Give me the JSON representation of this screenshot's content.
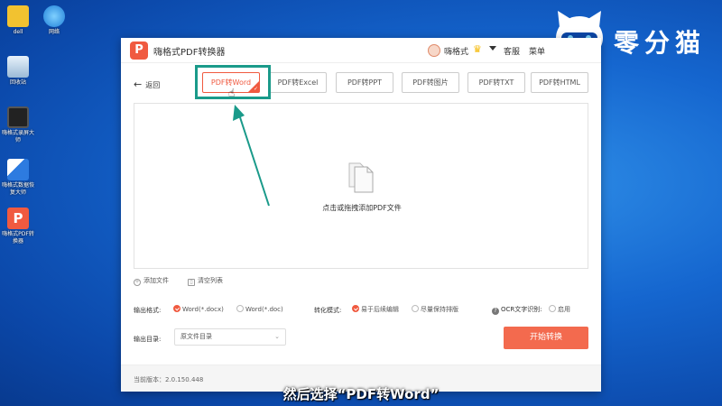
{
  "desktop": {
    "icons": [
      {
        "label": "dell"
      },
      {
        "label": "网络"
      },
      {
        "label": "回收站"
      },
      {
        "label": "嗨格式录屏大师"
      },
      {
        "label": "嗨格式数据恢复大师"
      },
      {
        "label": "嗨格式PDF转换器"
      }
    ]
  },
  "brand": {
    "name": "零分猫"
  },
  "app": {
    "logo": "P",
    "title": "嗨格式PDF转换器",
    "user": "嗨格式",
    "service": "客服",
    "menu": "菜单"
  },
  "nav": {
    "back": "返回"
  },
  "tabs": [
    {
      "label": "PDF转Word",
      "active": true
    },
    {
      "label": "PDF转Excel"
    },
    {
      "label": "PDF转PPT"
    },
    {
      "label": "PDF转图片"
    },
    {
      "label": "PDF转TXT"
    },
    {
      "label": "PDF转HTML"
    }
  ],
  "dropzone": {
    "text": "点击或拖拽添加PDF文件"
  },
  "file_actions": {
    "add": "添加文件",
    "clear": "清空列表"
  },
  "options": {
    "format_label": "输出格式:",
    "format_docx": "Word(*.docx)",
    "format_doc": "Word(*.doc)",
    "mode_label": "转化模式:",
    "mode_edit": "易于后续编辑",
    "mode_layout": "尽量保持排版",
    "ocr_label": "OCR文字识别:",
    "ocr_enable": "启用",
    "dir_label": "输出目录:",
    "dir_value": "原文件目录"
  },
  "start_button": "开始转换",
  "version": "当前版本：2.0.150.448",
  "subtitle": "然后选择“PDF转Word”",
  "colors": {
    "accent": "#f05a40",
    "highlight": "#1a9a8a",
    "desktop": "#1566cf"
  }
}
